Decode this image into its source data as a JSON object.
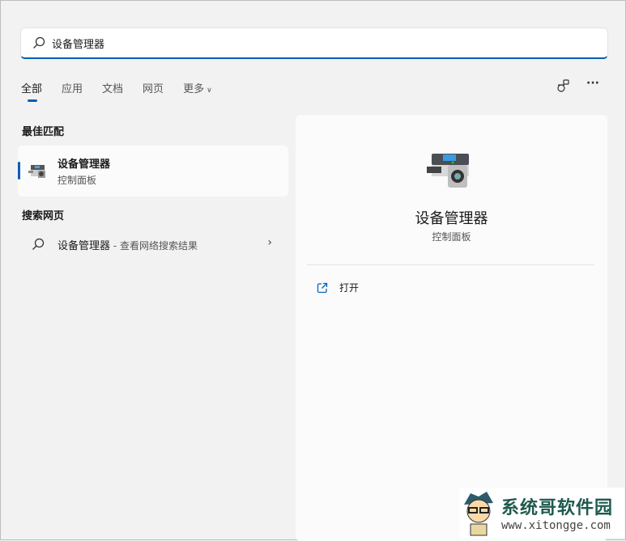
{
  "search": {
    "value": "设备管理器",
    "placeholder": ""
  },
  "tabs": [
    {
      "label": "全部"
    },
    {
      "label": "应用"
    },
    {
      "label": "文档"
    },
    {
      "label": "网页"
    },
    {
      "label": "更多"
    }
  ],
  "toolbar": {
    "share_icon": "share-icon",
    "more_label": "···"
  },
  "best_match": {
    "heading": "最佳匹配",
    "title": "设备管理器",
    "subtitle": "控制面板"
  },
  "web_search": {
    "heading": "搜索网页",
    "query": "设备管理器",
    "suffix": " - 查看网络搜索结果"
  },
  "detail": {
    "title": "设备管理器",
    "subtitle": "控制面板",
    "open_label": "打开"
  },
  "watermark": {
    "name": "系统哥软件园",
    "url": "www.xitongge.com"
  },
  "colors": {
    "accent": "#005fb8"
  }
}
